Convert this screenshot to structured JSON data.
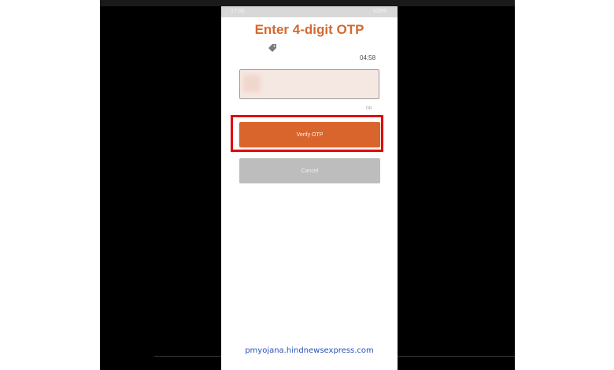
{
  "status_bar": {
    "time": "17:00",
    "icons": "⚙ ◎ ▣",
    "battery": "100%"
  },
  "screen": {
    "title": "Enter 4-digit OTP",
    "timer": "04:58",
    "otp_placeholder": "",
    "resend_label": "OR"
  },
  "buttons": {
    "verify_label": "Verify OTP",
    "cancel_label": "Cancel"
  },
  "watermark": "pmyojana.hindnewsexpress.com",
  "colors": {
    "accent": "#d9652c",
    "title": "#d4692f",
    "highlight": "#e3000b",
    "cancel": "#bdbdbd",
    "watermark": "#2a52be"
  },
  "icons": {
    "tag": "tag-icon"
  }
}
